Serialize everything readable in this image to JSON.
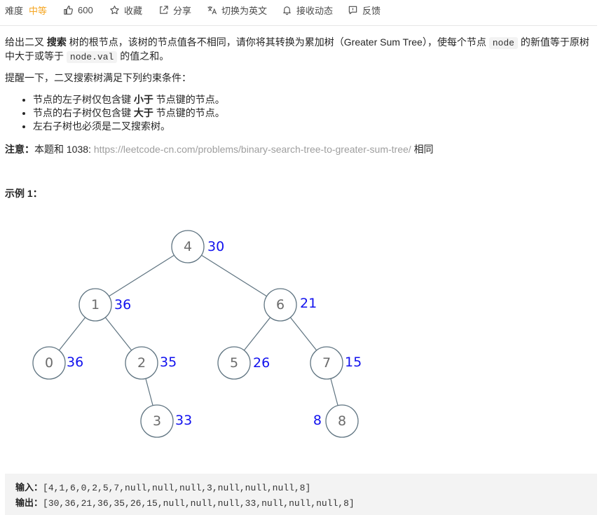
{
  "toolbar": {
    "difficulty_label": "难度",
    "difficulty_value": "中等",
    "likes": "600",
    "favorite": "收藏",
    "share": "分享",
    "switch_lang": "切换为英文",
    "notifications": "接收动态",
    "feedback": "反馈",
    "colors": {
      "difficulty_medium": "#f5a623"
    }
  },
  "problem": {
    "p1_a": "给出二叉 ",
    "p1_bold": "搜索",
    "p1_b": " 树的根节点，该树的节点值各不相同，请你将其转换为累加树（Greater Sum Tree），使每个节点 ",
    "p1_code1": "node",
    "p1_c": " 的新值等于原树中大于或等于 ",
    "p1_code2": "node.val",
    "p1_d": " 的值之和。",
    "p2": "提醒一下，二叉搜索树满足下列约束条件：",
    "bullets": [
      {
        "a": "节点的左子树仅包含键 ",
        "bold": "小于",
        "b": " 节点键的节点。"
      },
      {
        "a": "节点的右子树仅包含键 ",
        "bold": "大于",
        "b": " 节点键的节点。"
      },
      {
        "a": "左右子树也必须是二叉搜索树。",
        "bold": "",
        "b": ""
      }
    ],
    "note_label": "注意：",
    "note_a": "本题和 1038: ",
    "note_link": "https://leetcode-cn.com/problems/binary-search-tree-to-greater-sum-tree/",
    "note_b": " 相同",
    "example_title": "示例 1："
  },
  "tree": {
    "nodes": [
      {
        "val": "4",
        "sum": "30"
      },
      {
        "val": "1",
        "sum": "36"
      },
      {
        "val": "6",
        "sum": "21"
      },
      {
        "val": "0",
        "sum": "36"
      },
      {
        "val": "2",
        "sum": "35"
      },
      {
        "val": "5",
        "sum": "26"
      },
      {
        "val": "7",
        "sum": "15"
      },
      {
        "val": "3",
        "sum": "33"
      },
      {
        "val": "8",
        "sum": "8"
      }
    ],
    "colors": {
      "sum": "#1111ee",
      "edge": "#5e7380"
    }
  },
  "example": {
    "input_label": "输入：",
    "input_value": "[4,1,6,0,2,5,7,null,null,null,3,null,null,null,8]",
    "output_label": "输出：",
    "output_value": "[30,36,21,36,35,26,15,null,null,null,33,null,null,null,8]"
  }
}
